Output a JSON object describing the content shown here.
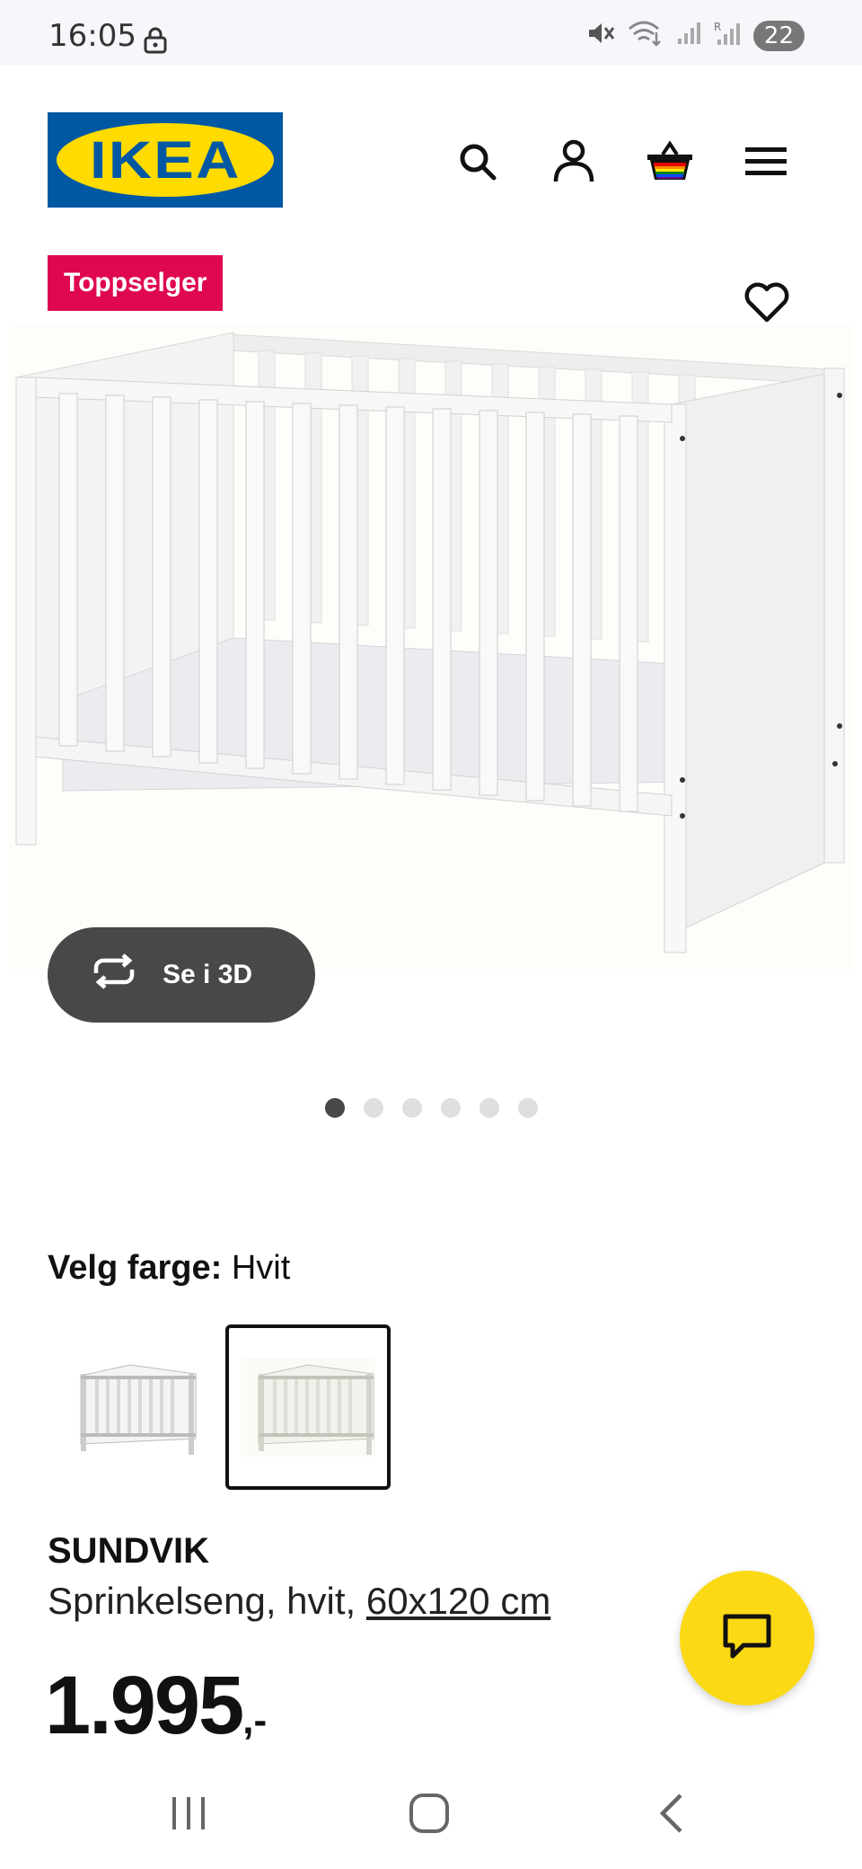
{
  "status_bar": {
    "time": "16:05",
    "battery": "22",
    "icons": [
      "lock-icon",
      "mute-icon",
      "wifi-icon",
      "signal-icon",
      "signal-roaming-icon"
    ]
  },
  "header": {
    "logo_text": "IKEA",
    "icons": [
      "search-icon",
      "user-icon",
      "basket-icon",
      "menu-icon"
    ]
  },
  "product_media": {
    "badge": "Toppselger",
    "view_3d_label": "Se i 3D",
    "image_count": 6,
    "active_image": 1
  },
  "color_selector": {
    "label": "Velg farge:",
    "value": "Hvit",
    "selected_index": 1
  },
  "product": {
    "name": "SUNDVIK",
    "description": "Sprinkelseng, hvit,",
    "size": "60x120 cm",
    "price": "1.995",
    "price_suffix": ",-"
  },
  "colors": {
    "brand_blue": "#0058a3",
    "brand_yellow": "#ffdb00",
    "badge": "#e00751",
    "chat_button": "#fbd914",
    "dark_button": "#484848"
  }
}
